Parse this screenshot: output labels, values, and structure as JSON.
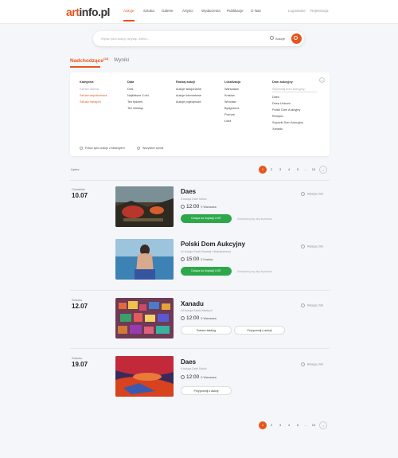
{
  "header": {
    "logo_a": "art",
    "logo_b": "info.pl",
    "nav": [
      "Aukcje",
      "Sztuka",
      "Galerie",
      "Artyści",
      "Wydarzenia",
      "Publikacje",
      "O Nas"
    ],
    "login": "Logowanie",
    "register": "Rejestracja"
  },
  "search": {
    "placeholder": "Wpisz tytuł aukcji, artystę, dzieło...",
    "category": "Aukcje"
  },
  "tabs": {
    "upcoming": "Nadchodzące",
    "upcoming_count": "(14)",
    "results": "Wyniki"
  },
  "filters": {
    "category": {
      "title": "Kategoria",
      "items": [
        "Sztuka dawna",
        "Sztuka współczesna",
        "Sztuka młodych"
      ]
    },
    "date": {
      "title": "Data",
      "items": [
        "Dziś",
        "Najbliższe 3 dni",
        "Ten tydzień",
        "Ten miesiąc"
      ]
    },
    "type": {
      "title": "Rodzaj aukcji",
      "items": [
        "Aukcje stacjonarne",
        "Aukcje internetowe",
        "Aukcje pojedyncze"
      ]
    },
    "location": {
      "title": "Lokalizacja",
      "items": [
        "Warszawa",
        "Kraków",
        "Wrocław",
        "Bydgoszcz",
        "Poznań",
        "Łódź"
      ]
    },
    "houses": {
      "title": "Dom aukcyjny",
      "search_placeholder": "Wyszukaj dom aukcyjny...",
      "items": [
        "Daes",
        "Desa Unicum",
        "Polski Dom Aukcyjny",
        "Rempex",
        "Sopocki Dom Aukcyjny",
        "Xanadu"
      ]
    },
    "check1": "Pokaż tylko aukcje z katalogiem",
    "check2": "Wszystkie wyniki",
    "close": "×"
  },
  "list": {
    "head": "Lipiec"
  },
  "pagination": {
    "pages": [
      "1",
      "2",
      "3",
      "4",
      "5",
      "...",
      "10"
    ],
    "next": "›",
    "current": "1"
  },
  "days": [
    {
      "name": "Czwartek",
      "date": "10.07"
    },
    {
      "name": "Sobota",
      "date": "12.07"
    },
    {
      "name": "Sobota",
      "date": "19.07"
    }
  ],
  "events": [
    {
      "title": "Daes",
      "sub": "8 Aukcja Dzieł Sztuki",
      "time": "12:00",
      "loc": "Warszawa",
      "btn": "Dołącz do licytacji LIVE",
      "reg": "Zarejestruj się aby licytować",
      "live": "Relacja LIVE"
    },
    {
      "title": "Polski Dom Aukcyjny",
      "sub": "41 Aukcja Sztuki Dawnej i Współczesnej",
      "time": "15:00",
      "loc": "Kraków",
      "btn": "Dołącz do licytacji LIVE",
      "reg": "Zarejestruj się aby licytować",
      "live": "Relacja LIVE"
    },
    {
      "title": "Xanadu",
      "sub": "14 Aukcja Sztuki Młodych",
      "time": "12:00",
      "loc": "Warszawa",
      "btn1": "Zobacz katalog",
      "btn2": "Przypomnij o aukcji",
      "live": "Relacja LIVE"
    },
    {
      "title": "Daes",
      "sub": "9 Aukcja Dzieł Sztuki",
      "time": "12:00",
      "loc": "Warszawa",
      "btn2": "Przypomnij o aukcji",
      "live": "Relacja LIVE"
    }
  ],
  "colors": {
    "accent": "#e8541e",
    "live_green": "#2ca84b"
  }
}
